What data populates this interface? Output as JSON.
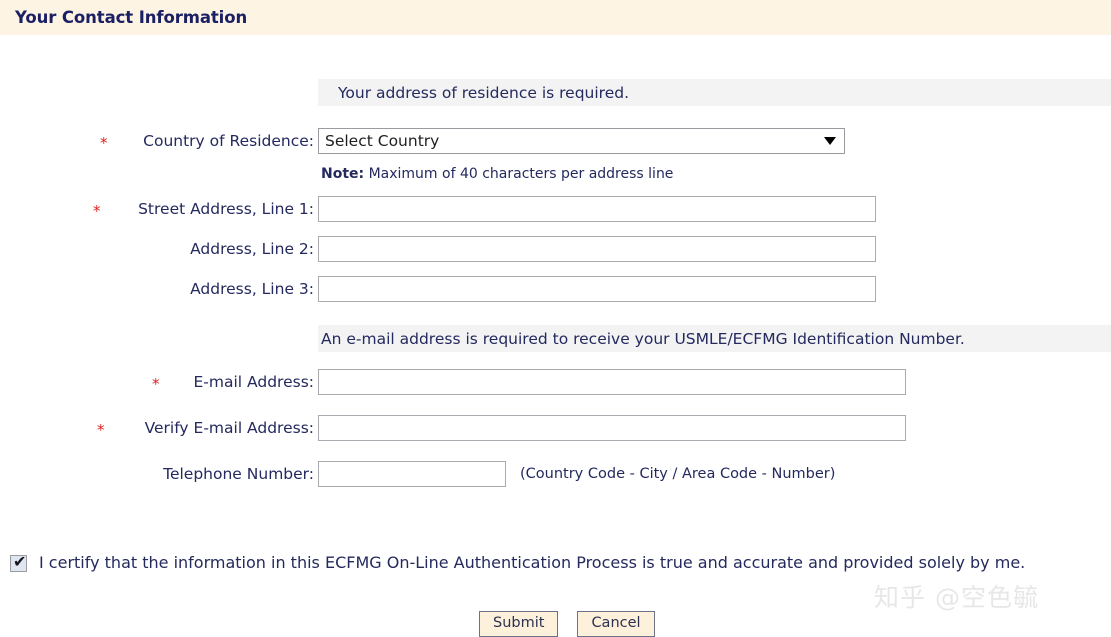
{
  "header": {
    "title": "Your Contact Information",
    "background": "#fdf4e3",
    "text_color": "#1b1f63"
  },
  "address_section": {
    "info_text": "Your address of residence is required.",
    "country": {
      "label": "Country of Residence:",
      "required_marker": "*",
      "selected_option": "Select Country",
      "arrow_icon": "chevron-down-icon"
    },
    "note": {
      "prefix": "Note:",
      "text": " Maximum of 40 characters per address line"
    },
    "line1": {
      "label": "Street Address, Line 1:",
      "required_marker": "*",
      "value": "",
      "placeholder": ""
    },
    "line2": {
      "label": "Address, Line 2:",
      "required_marker": "",
      "value": "",
      "placeholder": ""
    },
    "line3": {
      "label": "Address, Line 3:",
      "required_marker": "",
      "value": "",
      "placeholder": ""
    }
  },
  "email_section": {
    "info_text": "An e-mail address is required to receive your USMLE/ECFMG Identification Number.",
    "email": {
      "label": "E-mail Address:",
      "required_marker": "*",
      "value": "",
      "placeholder": ""
    },
    "verify_email": {
      "label": "Verify E-mail Address:",
      "required_marker": "*",
      "value": "",
      "placeholder": ""
    },
    "telephone": {
      "label": "Telephone Number:",
      "required_marker": "",
      "value": "",
      "placeholder": "",
      "hint": "(Country Code - City / Area Code - Number)"
    }
  },
  "certify": {
    "checked": true,
    "check_glyph": "✔",
    "text": "I certify that the information in this ECFMG On-Line Authentication Process is true and accurate and provided solely by me."
  },
  "actions": {
    "submit_label": "Submit",
    "cancel_label": "Cancel"
  },
  "watermark": {
    "text": "知乎 @空色毓"
  },
  "colors": {
    "accent_navy": "#24295e",
    "required_red": "#e02020",
    "info_bar_grey": "#f3f3f4",
    "button_cream": "#fdf1dc"
  }
}
